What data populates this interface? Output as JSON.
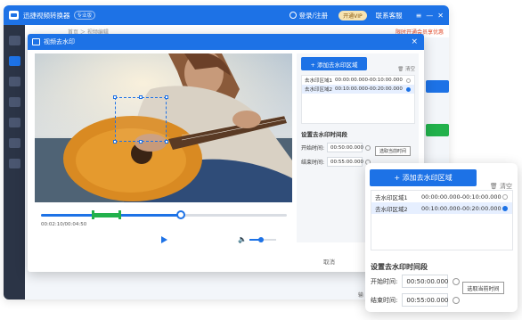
{
  "app": {
    "title": "迅捷视频转换器",
    "badge": "专业版",
    "user": "登录/注册",
    "vip": "开通VIP",
    "service": "联系客服",
    "window_controls": [
      "≡",
      "—",
      "✕"
    ],
    "breadcrumb": "首页 ＞ 视频编辑",
    "notice": "限时开通会员享优惠",
    "footer_text": "输"
  },
  "dialog": {
    "title": "视频去水印",
    "close": "×",
    "cancel": "取消",
    "time_label": "00:02:10/00:04:50",
    "timeline": {
      "position": 0.57,
      "segment_start": 0.21,
      "segment_end": 0.32
    },
    "volume": 0.45
  },
  "panel": {
    "add_label": "+ 添加去水印区域",
    "clear_label": "清空",
    "areas": [
      {
        "name": "去水印区域1",
        "range": "00:00:00.000-00:10:00.000",
        "selected": false
      },
      {
        "name": "去水印区域2",
        "range": "00:10:00.000-00:20:00.000",
        "selected": true
      }
    ],
    "section_title": "设置去水印时间段",
    "start_label": "开始时间:",
    "start_value": "00:50:00.000",
    "end_label": "结束时间:",
    "end_value": "00:55:00.000",
    "pick_label": "选取当前时间"
  },
  "icons": {
    "trash": "trash-icon",
    "play": "play-icon",
    "volume": "volume-icon",
    "logo": "app-logo-icon"
  },
  "colors": {
    "primary": "#1d72e6",
    "segment": "#22b14c",
    "sidebar": "#2b3446"
  }
}
